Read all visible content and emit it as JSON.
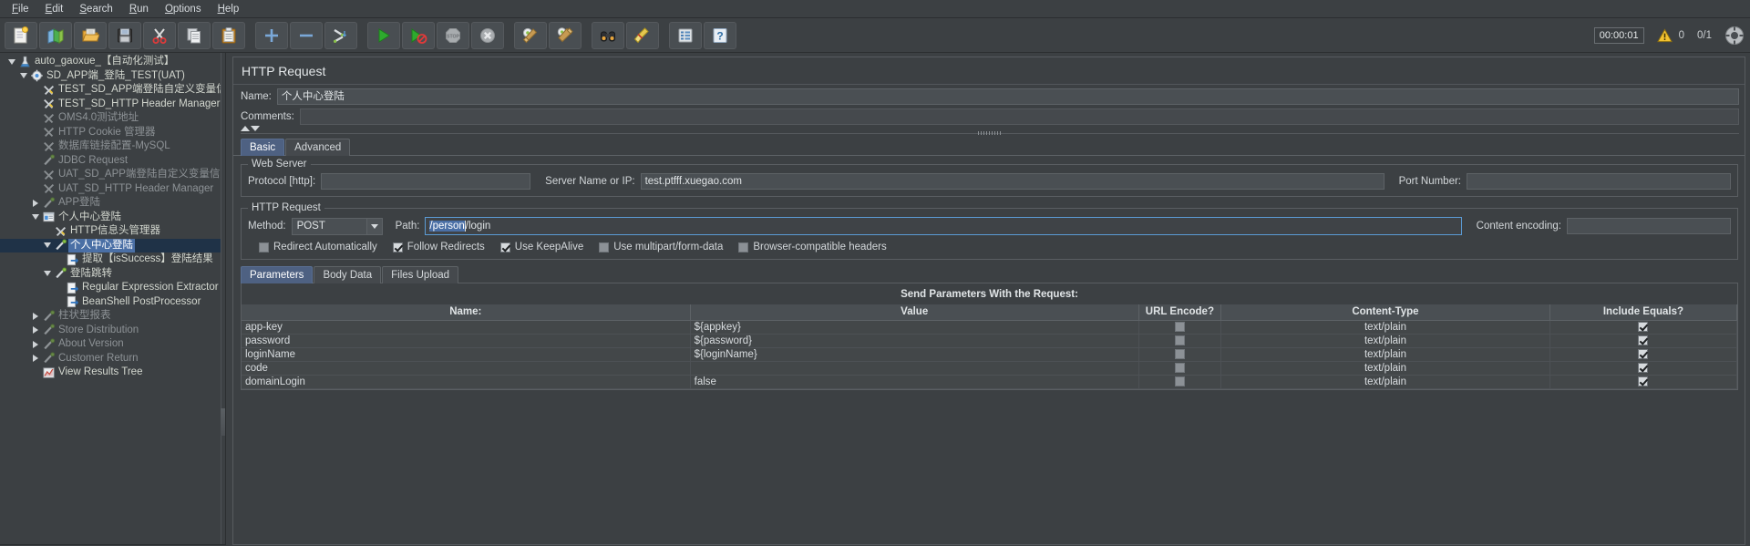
{
  "menubar": {
    "items": [
      {
        "label": "File",
        "mnemonic": "F"
      },
      {
        "label": "Edit",
        "mnemonic": "E"
      },
      {
        "label": "Search",
        "mnemonic": "S"
      },
      {
        "label": "Run",
        "mnemonic": "R"
      },
      {
        "label": "Options",
        "mnemonic": "O"
      },
      {
        "label": "Help",
        "mnemonic": "H"
      }
    ]
  },
  "toolbar": {
    "buttons": [
      {
        "name": "new-button",
        "icon": "new-document-icon"
      },
      {
        "name": "templates-button",
        "icon": "templates-icon"
      },
      {
        "name": "open-button",
        "icon": "open-folder-icon"
      },
      {
        "name": "save-button",
        "icon": "floppy-disk-icon"
      },
      {
        "name": "cut-button",
        "icon": "scissors-icon"
      },
      {
        "name": "copy-button",
        "icon": "copy-pages-icon"
      },
      {
        "name": "paste-button",
        "icon": "clipboard-icon"
      },
      {
        "name": "expand-all-button",
        "icon": "plus-icon"
      },
      {
        "name": "collapse-all-button",
        "icon": "minus-icon"
      },
      {
        "name": "toggle-button",
        "icon": "toggle-pencils-icon"
      },
      {
        "name": "start-button",
        "icon": "green-play-icon"
      },
      {
        "name": "start-no-pauses-button",
        "icon": "play-no-pause-icon"
      },
      {
        "name": "stop-button",
        "icon": "stop-sign-icon"
      },
      {
        "name": "shutdown-button",
        "icon": "shutdown-x-icon"
      },
      {
        "name": "clear-button",
        "icon": "gear-broom-icon"
      },
      {
        "name": "clear-all-button",
        "icon": "gears-broom-icon"
      },
      {
        "name": "search-button",
        "icon": "binoculars-icon"
      },
      {
        "name": "reset-search-button",
        "icon": "broom-icon"
      },
      {
        "name": "function-helper-button",
        "icon": "function-list-icon"
      },
      {
        "name": "help-button",
        "icon": "question-help-icon"
      }
    ],
    "timer": "00:00:01",
    "warning_count": "0",
    "thread_count": "0/1",
    "remote_icon": "connection-status-icon"
  },
  "tree": {
    "nodes": [
      {
        "label": "auto_gaoxue_【自动化测试】",
        "indent": 0,
        "toggle": "down",
        "icon": "test-plan-icon",
        "disabled": false,
        "selected": false
      },
      {
        "label": "SD_APP端_登陆_TEST(UAT)",
        "indent": 1,
        "toggle": "down",
        "icon": "thread-group-icon",
        "disabled": false,
        "selected": false
      },
      {
        "label": "TEST_SD_APP端登陆自定义变量信息",
        "indent": 2,
        "toggle": "none",
        "icon": "config-element-icon",
        "disabled": false,
        "selected": false
      },
      {
        "label": "TEST_SD_HTTP Header Manager",
        "indent": 2,
        "toggle": "none",
        "icon": "config-element-icon",
        "disabled": false,
        "selected": false
      },
      {
        "label": "OMS4.0测试地址",
        "indent": 2,
        "toggle": "none",
        "icon": "config-element-disabled-icon",
        "disabled": true,
        "selected": false
      },
      {
        "label": "HTTP Cookie 管理器",
        "indent": 2,
        "toggle": "none",
        "icon": "config-element-disabled-icon",
        "disabled": true,
        "selected": false
      },
      {
        "label": "数据库链接配置-MySQL",
        "indent": 2,
        "toggle": "none",
        "icon": "config-element-disabled-icon",
        "disabled": true,
        "selected": false
      },
      {
        "label": "JDBC Request",
        "indent": 2,
        "toggle": "none",
        "icon": "sampler-disabled-icon",
        "disabled": true,
        "selected": false
      },
      {
        "label": "UAT_SD_APP端登陆自定义变量信息",
        "indent": 2,
        "toggle": "none",
        "icon": "config-element-disabled-icon",
        "disabled": true,
        "selected": false
      },
      {
        "label": "UAT_SD_HTTP Header Manager",
        "indent": 2,
        "toggle": "none",
        "icon": "config-element-disabled-icon",
        "disabled": true,
        "selected": false
      },
      {
        "label": "APP登陆",
        "indent": 2,
        "toggle": "right",
        "icon": "sampler-disabled-icon",
        "disabled": true,
        "selected": false
      },
      {
        "label": "个人中心登陆",
        "indent": 2,
        "toggle": "down",
        "icon": "transaction-controller-icon",
        "disabled": false,
        "selected": false
      },
      {
        "label": "HTTP信息头管理器",
        "indent": 3,
        "toggle": "none",
        "icon": "config-element-icon",
        "disabled": false,
        "selected": false
      },
      {
        "label": "个人中心登陆",
        "indent": 3,
        "toggle": "down",
        "icon": "sampler-icon",
        "disabled": false,
        "selected": true
      },
      {
        "label": "提取【isSuccess】登陆结果",
        "indent": 4,
        "toggle": "none",
        "icon": "post-processor-icon",
        "disabled": false,
        "selected": false
      },
      {
        "label": "登陆跳转",
        "indent": 3,
        "toggle": "down",
        "icon": "sampler-icon",
        "disabled": false,
        "selected": false
      },
      {
        "label": "Regular Expression Extractor",
        "indent": 4,
        "toggle": "none",
        "icon": "post-processor-icon",
        "disabled": false,
        "selected": false
      },
      {
        "label": "BeanShell PostProcessor",
        "indent": 4,
        "toggle": "none",
        "icon": "post-processor-icon",
        "disabled": false,
        "selected": false
      },
      {
        "label": "柱状型报表",
        "indent": 2,
        "toggle": "right",
        "icon": "listener-disabled-icon",
        "disabled": true,
        "selected": false
      },
      {
        "label": "Store Distribution",
        "indent": 2,
        "toggle": "right",
        "icon": "listener-disabled-icon",
        "disabled": true,
        "selected": false
      },
      {
        "label": "About Version",
        "indent": 2,
        "toggle": "right",
        "icon": "listener-disabled-icon",
        "disabled": true,
        "selected": false
      },
      {
        "label": "Customer Return",
        "indent": 2,
        "toggle": "right",
        "icon": "listener-disabled-icon",
        "disabled": true,
        "selected": false
      },
      {
        "label": "View Results Tree",
        "indent": 2,
        "toggle": "none",
        "icon": "view-results-tree-icon",
        "disabled": false,
        "selected": false
      }
    ]
  },
  "http_request": {
    "panel_title": "HTTP Request",
    "name_label": "Name:",
    "name_value": "个人中心登陆",
    "comments_label": "Comments:",
    "comments_value": "",
    "main_tabs": [
      {
        "label": "Basic",
        "active": true
      },
      {
        "label": "Advanced",
        "active": false
      }
    ],
    "web_server": {
      "group_title": "Web Server",
      "protocol_label": "Protocol [http]:",
      "protocol_value": "",
      "server_label": "Server Name or IP:",
      "server_value": "test.ptfff.xuegao.com",
      "port_label": "Port Number:",
      "port_value": ""
    },
    "request": {
      "group_title": "HTTP Request",
      "method_label": "Method:",
      "method_value": "POST",
      "path_label": "Path:",
      "path_selected_text": "/person",
      "path_rest_text": "/login",
      "content_encoding_label": "Content encoding:",
      "content_encoding_value": ""
    },
    "checkboxes": [
      {
        "label": "Redirect Automatically",
        "checked": false
      },
      {
        "label": "Follow Redirects",
        "checked": true
      },
      {
        "label": "Use KeepAlive",
        "checked": true
      },
      {
        "label": "Use multipart/form-data",
        "checked": false
      },
      {
        "label": "Browser-compatible headers",
        "checked": false
      }
    ],
    "param_tabs": [
      {
        "label": "Parameters",
        "active": true
      },
      {
        "label": "Body Data",
        "active": false
      },
      {
        "label": "Files Upload",
        "active": false
      }
    ],
    "table": {
      "caption": "Send Parameters With the Request:",
      "columns": [
        "Name:",
        "Value",
        "URL Encode?",
        "Content-Type",
        "Include Equals?"
      ],
      "rows": [
        {
          "name": "app-key",
          "value": "${appkey}",
          "url_encode": false,
          "content_type": "text/plain",
          "include_equals": true
        },
        {
          "name": "password",
          "value": "${password}",
          "url_encode": false,
          "content_type": "text/plain",
          "include_equals": true
        },
        {
          "name": "loginName",
          "value": "${loginName}",
          "url_encode": false,
          "content_type": "text/plain",
          "include_equals": true
        },
        {
          "name": "code",
          "value": "",
          "url_encode": false,
          "content_type": "text/plain",
          "include_equals": true
        },
        {
          "name": "domainLogin",
          "value": "false",
          "url_encode": false,
          "content_type": "text/plain",
          "include_equals": true
        }
      ]
    }
  },
  "colors": {
    "background": "#3c4043",
    "selection": "#4a6fa5",
    "accent_tab": "#4e6182",
    "focus_border": "#5b9bd5",
    "text": "#d3d7cf",
    "disabled_text": "#8d9296"
  }
}
